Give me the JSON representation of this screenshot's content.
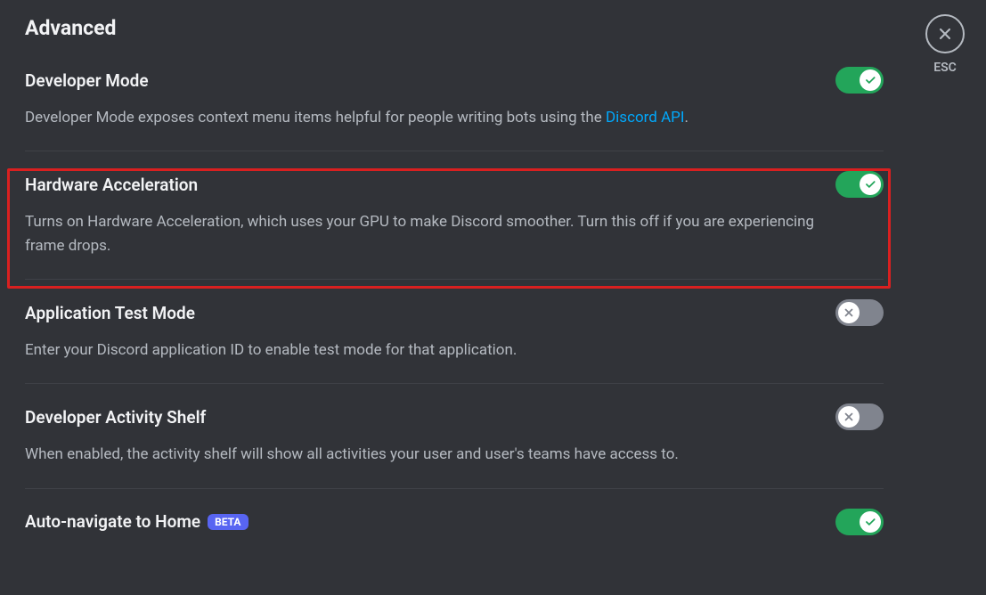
{
  "page_title": "Advanced",
  "esc_label": "ESC",
  "sections": {
    "developer_mode": {
      "title": "Developer Mode",
      "desc_prefix": "Developer Mode exposes context menu items helpful for people writing bots using the ",
      "link_text": "Discord API",
      "desc_suffix": ".",
      "toggle_on": true
    },
    "hardware_accel": {
      "title": "Hardware Acceleration",
      "desc": "Turns on Hardware Acceleration, which uses your GPU to make Discord smoother. Turn this off if you are experiencing frame drops.",
      "toggle_on": true
    },
    "app_test_mode": {
      "title": "Application Test Mode",
      "desc": "Enter your Discord application ID to enable test mode for that application.",
      "toggle_on": false
    },
    "activity_shelf": {
      "title": "Developer Activity Shelf",
      "desc": "When enabled, the activity shelf will show all activities your user and user's teams have access to.",
      "toggle_on": false
    },
    "auto_navigate": {
      "title": "Auto-navigate to Home",
      "badge": "BETA",
      "toggle_on": true
    }
  }
}
